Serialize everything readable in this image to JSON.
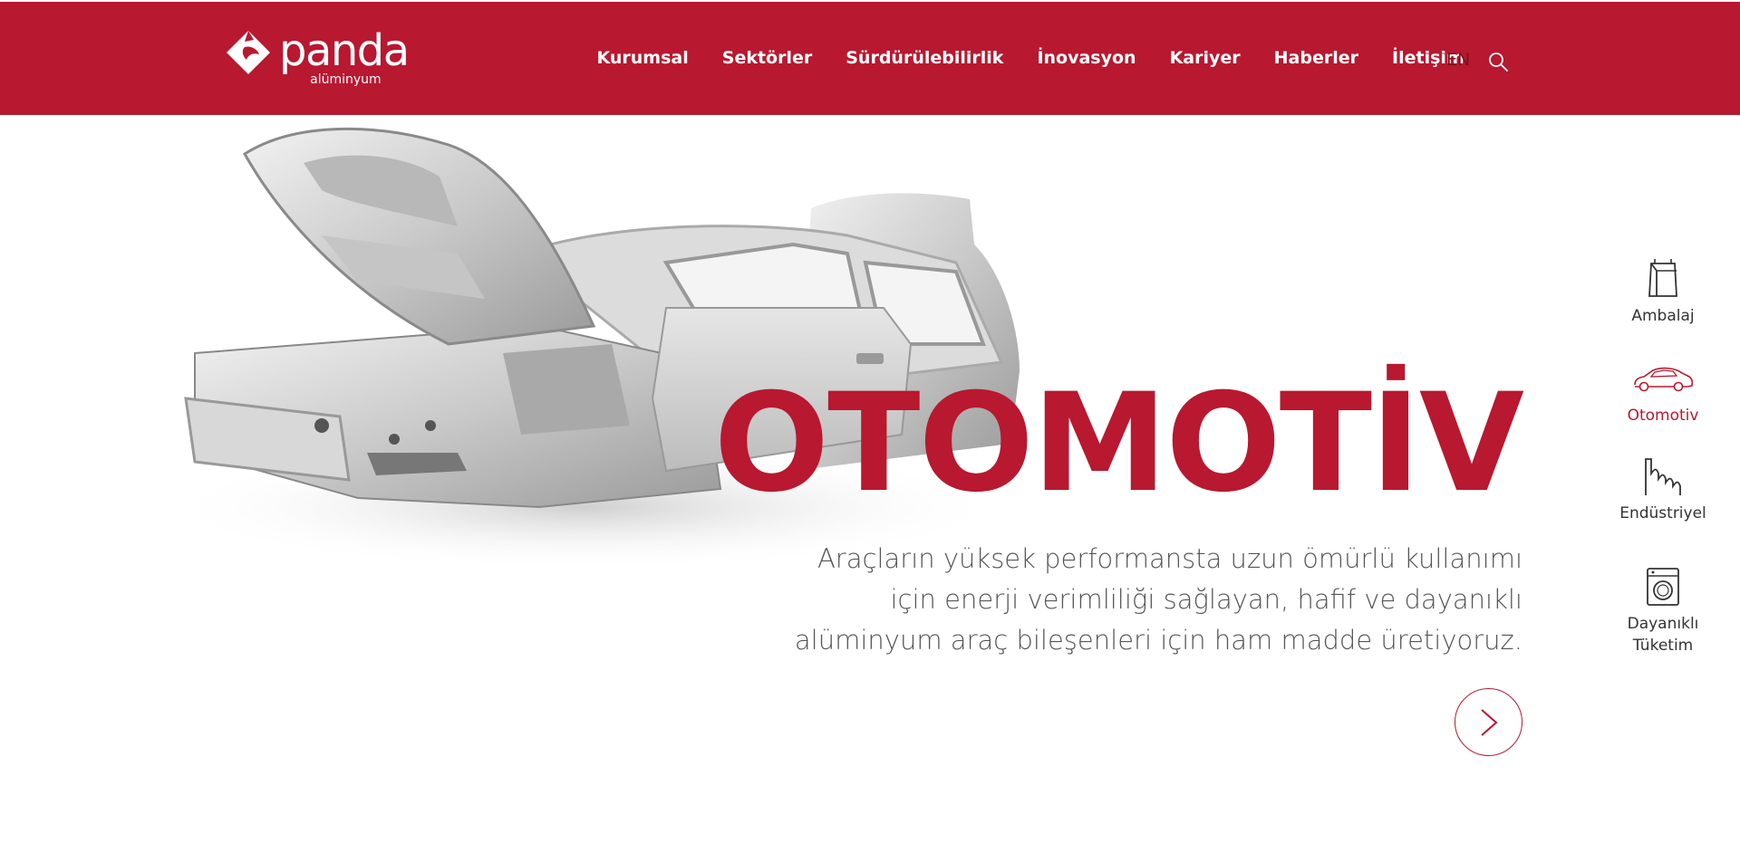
{
  "brand": {
    "name": "panda",
    "sub": "alüminyum",
    "color": "#b81830"
  },
  "nav": {
    "items": [
      {
        "label": "Kurumsal"
      },
      {
        "label": "Sektörler"
      },
      {
        "label": "Sürdürülebilirlik"
      },
      {
        "label": "İnovasyon"
      },
      {
        "label": "Kariyer"
      },
      {
        "label": "Haberler"
      },
      {
        "label": "İletişim"
      }
    ],
    "lang": "EN",
    "search_icon": "search-icon"
  },
  "hero": {
    "title": "OTOMOTİV",
    "description": "Araçların yüksek performansta uzun ömürlü kullanımı için enerji verimliliği sağlayan, hafif ve dayanıklı alüminyum araç bileşenleri için ham madde üretiyoruz.",
    "next_icon": "chevron-right-icon"
  },
  "sectors": [
    {
      "label": "Ambalaj",
      "icon": "package-icon",
      "active": false
    },
    {
      "label": "Otomotiv",
      "icon": "car-icon",
      "active": true
    },
    {
      "label": "Endüstriyel",
      "icon": "factory-icon",
      "active": false
    },
    {
      "label": "Dayanıklı Tüketim",
      "icon": "washing-machine-icon",
      "active": false
    }
  ]
}
